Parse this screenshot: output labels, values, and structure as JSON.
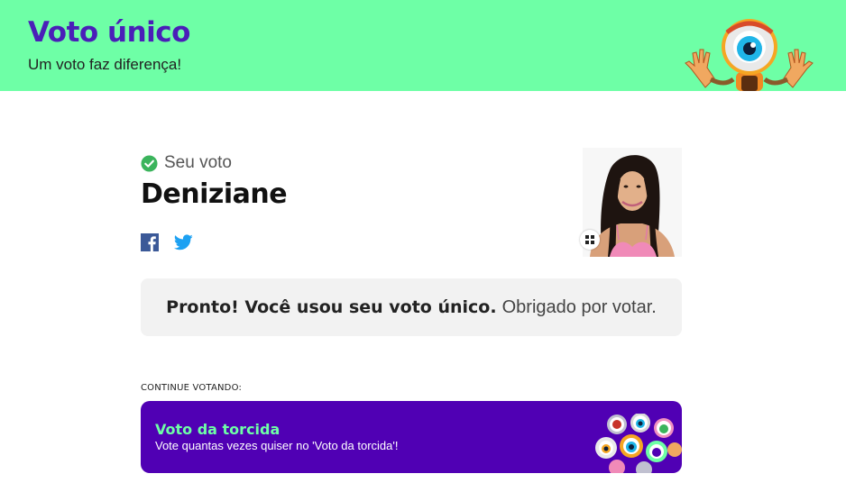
{
  "header": {
    "title": "Voto único",
    "subtitle": "Um voto faz diferença!",
    "background_color": "#6effa6",
    "title_color": "#4a1fb8",
    "mascot_icon": "big-brother-eye-mascot"
  },
  "vote": {
    "status_icon": "check-circle-icon",
    "status_label": "Seu voto",
    "candidate_name": "Deniziane",
    "share": {
      "facebook_icon": "facebook-icon",
      "twitter_icon": "twitter-icon"
    }
  },
  "message": {
    "strong": "Pronto! Você usou seu voto único.",
    "rest": "Obrigado por votar."
  },
  "continue": {
    "label": "CONTINUE VOTANDO:",
    "card": {
      "title": "Voto da torcida",
      "description": "Vote quantas vezes quiser no 'Voto da torcida'!",
      "background_color": "#5000b4",
      "title_color": "#6effa6"
    }
  }
}
